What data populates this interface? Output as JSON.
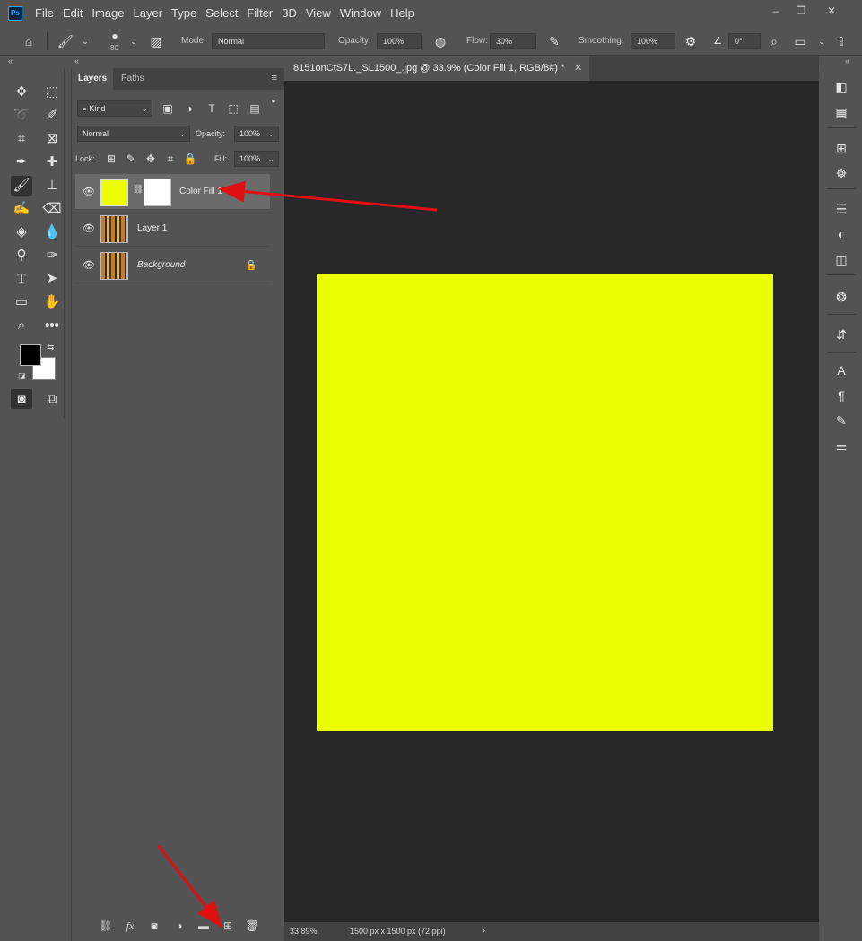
{
  "app": {
    "logo": "Ps",
    "menu": [
      "File",
      "Edit",
      "Image",
      "Layer",
      "Type",
      "Select",
      "Filter",
      "3D",
      "View",
      "Window",
      "Help"
    ]
  },
  "options": {
    "brush_size": "80",
    "mode_label": "Mode:",
    "mode_value": "Normal",
    "opacity_label": "Opacity:",
    "opacity_value": "100%",
    "flow_label": "Flow:",
    "flow_value": "30%",
    "smoothing_label": "Smoothing:",
    "smoothing_value": "100%",
    "angle_value": "0°"
  },
  "layers_panel": {
    "tab_layers": "Layers",
    "tab_paths": "Paths",
    "kind_label": "Kind",
    "blend_mode": "Normal",
    "opacity_label": "Opacity:",
    "opacity_value": "100%",
    "lock_label": "Lock:",
    "fill_label": "Fill:",
    "fill_value": "100%",
    "layers": [
      {
        "name": "Color Fill 1",
        "selected": true
      },
      {
        "name": "Layer 1",
        "selected": false
      },
      {
        "name": "Background",
        "selected": false,
        "locked": true
      }
    ],
    "footer_fx": "fx"
  },
  "document": {
    "tab_title": "8151onCtS7L._SL1500_.jpg @ 33.9% (Color Fill 1, RGB/8#) *",
    "fill_color": "#eaff00",
    "zoom": "33.89%",
    "doc_info": "1500 px x 1500 px (72 ppi)"
  },
  "colors": {
    "foreground": "#000000",
    "background": "#ffffff",
    "annotation_arrow": "#e01010"
  }
}
